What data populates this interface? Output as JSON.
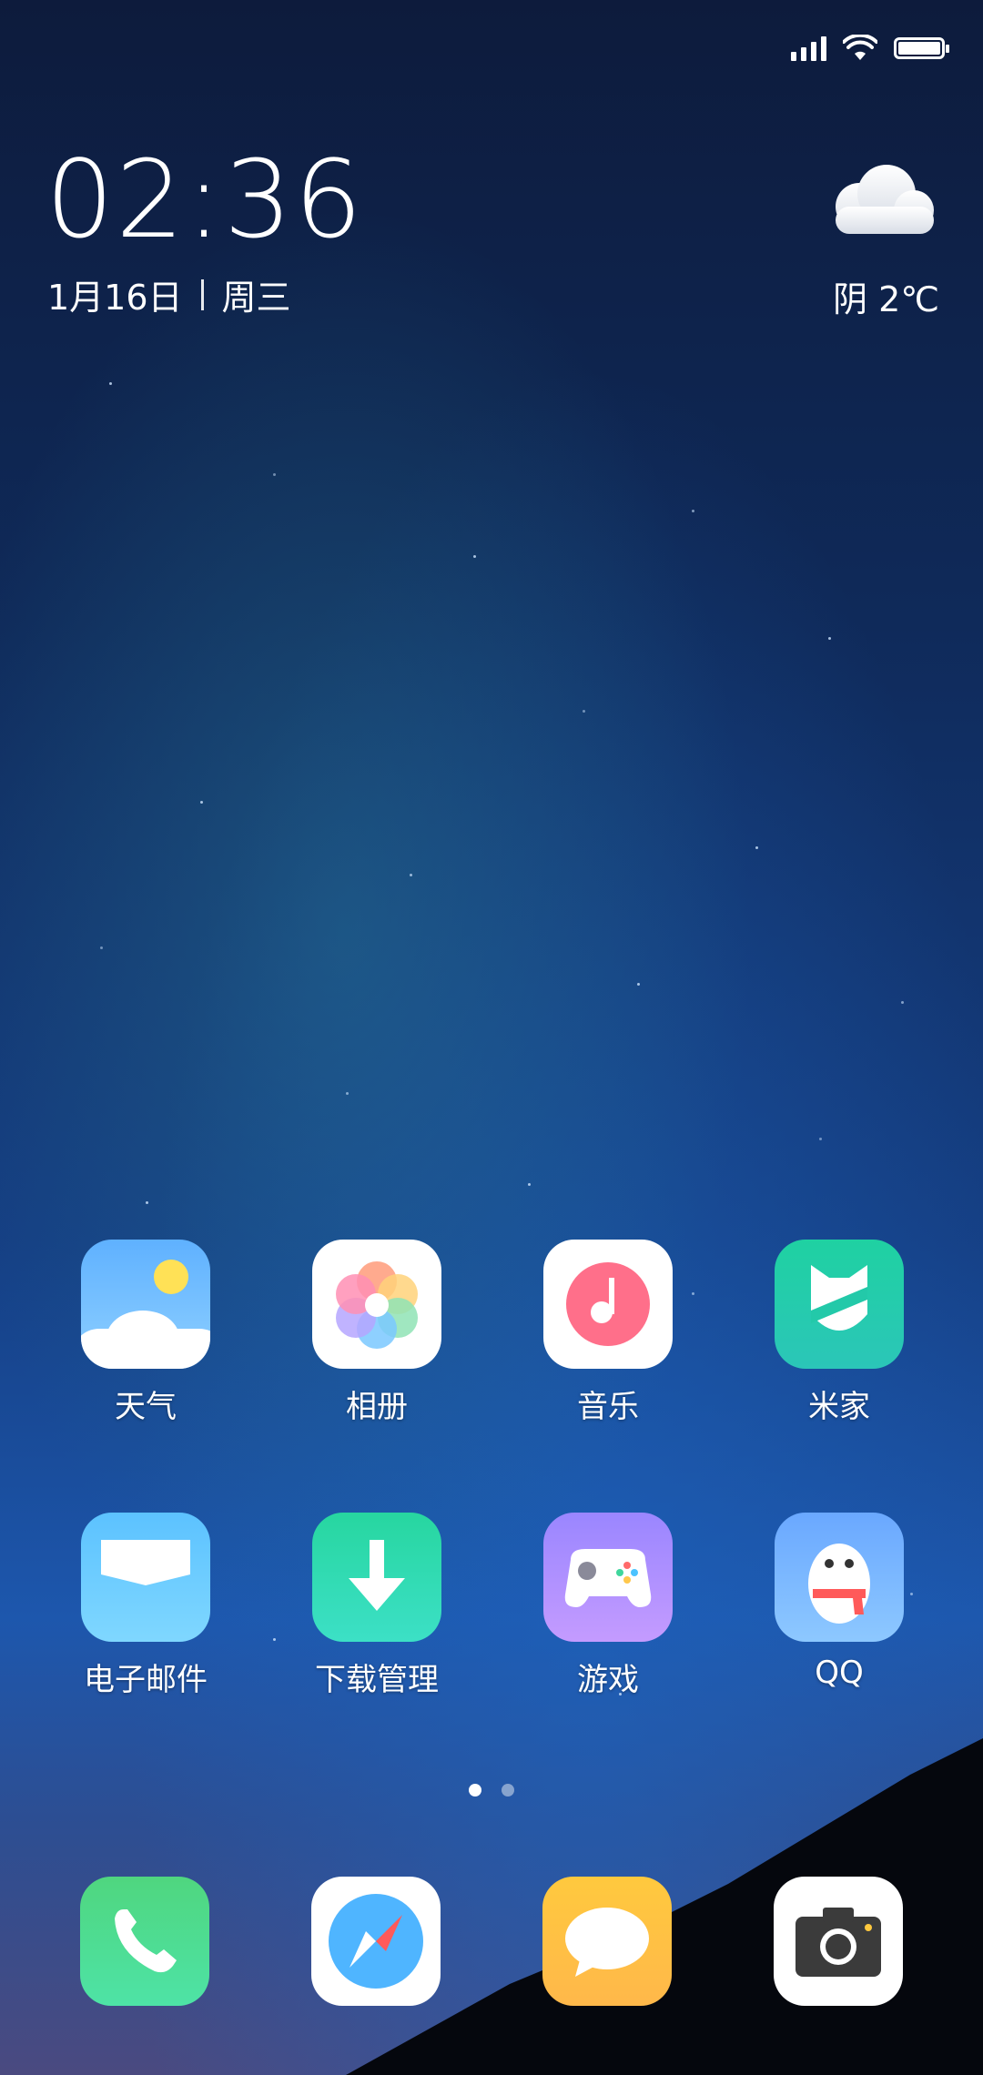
{
  "status_bar": {
    "signal_icon": "signal-icon",
    "wifi_icon": "wifi-icon",
    "battery_icon": "battery-icon"
  },
  "clock": {
    "time": "02:36",
    "date": "1月16日",
    "weekday": "周三"
  },
  "weather": {
    "icon": "cloud-icon",
    "text": "阴 2℃"
  },
  "apps_row1": [
    {
      "label": "天气",
      "icon": "weather-app-icon"
    },
    {
      "label": "相册",
      "icon": "gallery-app-icon"
    },
    {
      "label": "音乐",
      "icon": "music-app-icon"
    },
    {
      "label": "米家",
      "icon": "mijia-app-icon"
    }
  ],
  "apps_row2": [
    {
      "label": "电子邮件",
      "icon": "email-app-icon"
    },
    {
      "label": "下载管理",
      "icon": "downloads-app-icon"
    },
    {
      "label": "游戏",
      "icon": "games-app-icon"
    },
    {
      "label": "QQ",
      "icon": "qq-app-icon"
    }
  ],
  "page_indicator": {
    "pages": 2,
    "current": 1
  },
  "dock": [
    {
      "icon": "phone-icon"
    },
    {
      "icon": "browser-compass-icon"
    },
    {
      "icon": "messages-icon"
    },
    {
      "icon": "camera-icon"
    }
  ]
}
